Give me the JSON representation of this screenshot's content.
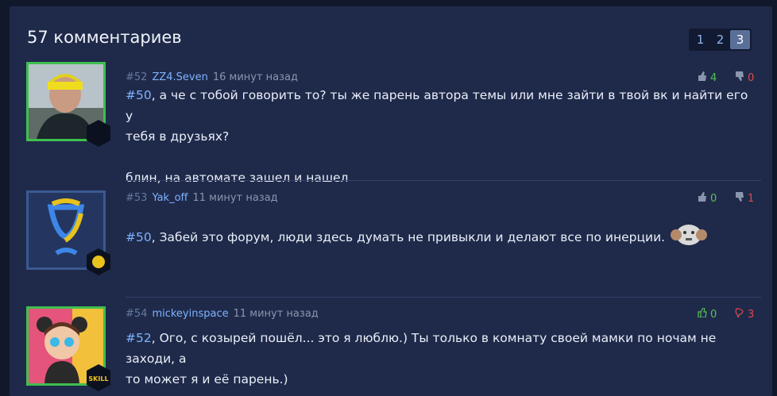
{
  "header": {
    "title": "57 комментариев"
  },
  "pagination": {
    "pages": [
      "1",
      "2",
      "3"
    ],
    "active": "3"
  },
  "colors": {
    "accent": "#7fb2ff",
    "upvote": "#57c257",
    "downvote": "#e04a4a",
    "avatar_border_green": "#3fbf4f"
  },
  "comments": [
    {
      "number": "#52",
      "author": "ZZ4.Seven",
      "time": "16 минут назад",
      "upvotes": "4",
      "downvotes": "0",
      "reply_ref": "#50",
      "text_line1": ", а че с тобой говорить то? ты же парень автора темы или мне зайти в твой вк и найти его у",
      "text_line2": "тебя в друзьях?",
      "text_line3": "блин, на автомате зашел и нашел"
    },
    {
      "number": "#53",
      "author": "Yak_off",
      "time": "11 минут назад",
      "upvotes": "0",
      "downvotes": "1",
      "reply_ref": "#50",
      "text_line1": ", Забей это форум, люди здесь думать не привыкли и делают все по инерции."
    },
    {
      "number": "#54",
      "author": "mickeyinspace",
      "time": "11 минут назад",
      "upvotes": "0",
      "downvotes": "3",
      "reply_ref": "#52",
      "text_line1": ", Ого, с козырей пошёл... это я люблю.) Ты только в комнату своей мамки по ночам не заходи, а",
      "text_line2": "то может я и её парень.)"
    }
  ],
  "badges": {
    "skill_badge_text": "SKILL"
  }
}
